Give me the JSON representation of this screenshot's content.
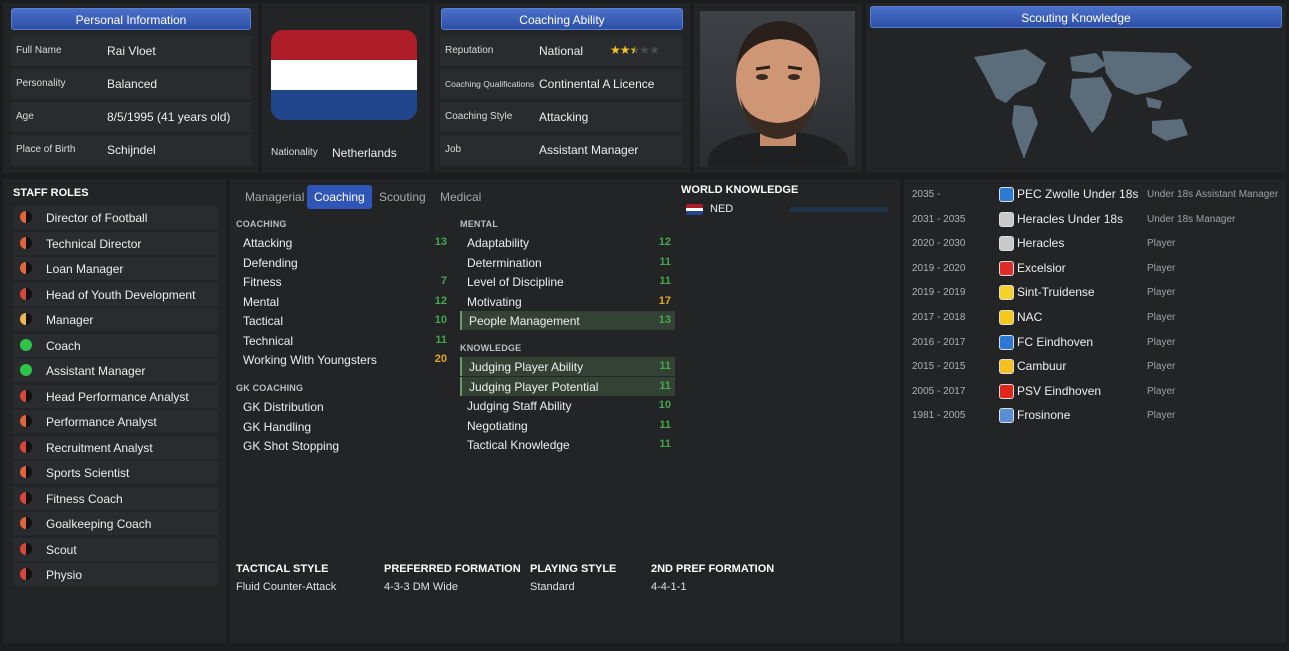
{
  "personal": {
    "header": "Personal Information",
    "rows": [
      {
        "label": "Full Name",
        "value": "Rai Vloet"
      },
      {
        "label": "Personality",
        "value": "Balanced"
      },
      {
        "label": "Age",
        "value": "8/5/1995 (41 years old)"
      },
      {
        "label": "Place of Birth",
        "value": "Schijndel"
      }
    ]
  },
  "nationality": {
    "label": "Nationality",
    "value": "Netherlands",
    "flag": [
      "#ae1c28",
      "#ffffff",
      "#21468b"
    ]
  },
  "coaching_ability": {
    "header": "Coaching Ability",
    "rows": [
      {
        "label": "Reputation",
        "value": "National",
        "stars": 2.5
      },
      {
        "label": "Coaching Qualifications",
        "value": "Continental A Licence"
      },
      {
        "label": "Coaching Style",
        "value": "Attacking"
      },
      {
        "label": "Job",
        "value": "Assistant Manager"
      }
    ]
  },
  "scouting": {
    "header": "Scouting Knowledge"
  },
  "staff_roles": {
    "title": "STAFF ROLES",
    "items": [
      {
        "label": "Director of Football",
        "color": "#e4643c",
        "level": 0.5
      },
      {
        "label": "Technical Director",
        "color": "#e4643c",
        "level": 0.5
      },
      {
        "label": "Loan Manager",
        "color": "#e4643c",
        "level": 0.6
      },
      {
        "label": "Head of Youth Development",
        "color": "#d9463a",
        "level": 0.3
      },
      {
        "label": "Manager",
        "color": "#f0b453",
        "level": 0.6
      },
      {
        "label": "Coach",
        "color": "#2ec44a",
        "level": 1
      },
      {
        "label": "Assistant Manager",
        "color": "#2ec44a",
        "level": 0.9
      },
      {
        "label": "Head Performance Analyst",
        "color": "#d9463a",
        "level": 0.3
      },
      {
        "label": "Performance Analyst",
        "color": "#e4643c",
        "level": 0.5
      },
      {
        "label": "Recruitment Analyst",
        "color": "#d9463a",
        "level": 0.3
      },
      {
        "label": "Sports Scientist",
        "color": "#e4643c",
        "level": 0.5
      },
      {
        "label": "Fitness Coach",
        "color": "#d9463a",
        "level": 0.3
      },
      {
        "label": "Goalkeeping Coach",
        "color": "#e4643c",
        "level": 0.5
      },
      {
        "label": "Scout",
        "color": "#d9463a",
        "level": 0.2
      },
      {
        "label": "Physio",
        "color": "#d9463a",
        "level": 0.3
      }
    ]
  },
  "tabs": [
    "Managerial",
    "Coaching",
    "Scouting",
    "Medical"
  ],
  "attributes": {
    "coaching": {
      "title": "COACHING",
      "items": [
        {
          "name": "Attacking",
          "value": "13"
        },
        {
          "name": "Defending",
          "value": ""
        },
        {
          "name": "Fitness",
          "value": "7"
        },
        {
          "name": "Mental",
          "value": "12"
        },
        {
          "name": "Tactical",
          "value": "10"
        },
        {
          "name": "Technical",
          "value": "11"
        },
        {
          "name": "Working With Youngsters",
          "value": "20"
        }
      ]
    },
    "gk": {
      "title": "GK COACHING",
      "items": [
        {
          "name": "GK Distribution",
          "value": ""
        },
        {
          "name": "GK Handling",
          "value": ""
        },
        {
          "name": "GK Shot Stopping",
          "value": ""
        }
      ]
    },
    "mental": {
      "title": "MENTAL",
      "items": [
        {
          "name": "Adaptability",
          "value": "12"
        },
        {
          "name": "Determination",
          "value": "11"
        },
        {
          "name": "Level of Discipline",
          "value": "11"
        },
        {
          "name": "Motivating",
          "value": "17"
        },
        {
          "name": "People Management",
          "value": "13"
        }
      ]
    },
    "knowledge": {
      "title": "KNOWLEDGE",
      "items": [
        {
          "name": "Judging Player Ability",
          "value": "11"
        },
        {
          "name": "Judging Player Potential",
          "value": "11"
        },
        {
          "name": "Judging Staff Ability",
          "value": "10"
        },
        {
          "name": "Negotiating",
          "value": "11"
        },
        {
          "name": "Tactical Knowledge",
          "value": "11"
        }
      ]
    }
  },
  "world_knowledge": {
    "title": "WORLD KNOWLEDGE",
    "items": [
      {
        "nation": "NED",
        "level": 0.0
      }
    ]
  },
  "tactics": [
    {
      "head": "TACTICAL STYLE",
      "value": "Fluid Counter-Attack"
    },
    {
      "head": "PREFERRED FORMATION",
      "value": "4-3-3 DM Wide"
    },
    {
      "head": "PLAYING STYLE",
      "value": "Standard"
    },
    {
      "head": "2ND PREF FORMATION",
      "value": "4-4-1-1"
    }
  ],
  "history": [
    {
      "years": "2035 -",
      "club": "PEC Zwolle Under 18s",
      "role": "Under 18s Assistant Manager",
      "crest": "#2a7bd1"
    },
    {
      "years": "2031 - 2035",
      "club": "Heracles Under 18s",
      "role": "Under 18s Manager",
      "crest": "#c9c9c9"
    },
    {
      "years": "2020 - 2030",
      "club": "Heracles",
      "role": "Player",
      "crest": "#c9c9c9"
    },
    {
      "years": "2019 - 2020",
      "club": "Excelsior",
      "role": "Player",
      "crest": "#e02b2b"
    },
    {
      "years": "2019 - 2019",
      "club": "Sint-Truidense",
      "role": "Player",
      "crest": "#f5d12b"
    },
    {
      "years": "2017 - 2018",
      "club": "NAC",
      "role": "Player",
      "crest": "#f2c81a"
    },
    {
      "years": "2016 - 2017",
      "club": "FC Eindhoven",
      "role": "Player",
      "crest": "#2e78d6"
    },
    {
      "years": "2015 - 2015",
      "club": "Cambuur",
      "role": "Player",
      "crest": "#f5c020"
    },
    {
      "years": "2005 - 2017",
      "club": "PSV Eindhoven",
      "role": "Player",
      "crest": "#e1261c"
    },
    {
      "years": "1981 - 2005",
      "club": "Frosinone",
      "role": "Player",
      "crest": "#5a8fd6"
    }
  ]
}
